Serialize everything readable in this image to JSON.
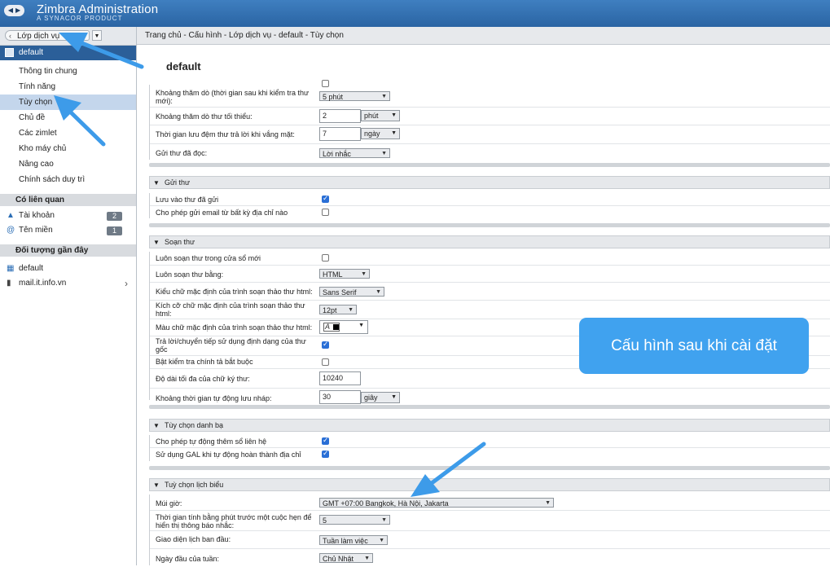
{
  "app": {
    "title": "Zimbra Administration",
    "subtitle": "A SYNACOR PRODUCT"
  },
  "nav": {
    "back_icon": "◀",
    "forward_icon": "▶"
  },
  "sidebar": {
    "breadcrumb_label": "Lớp dịch vụ",
    "selected": "default",
    "items": [
      {
        "label": "Thông tin chung"
      },
      {
        "label": "Tính năng"
      },
      {
        "label": "Tùy chọn"
      },
      {
        "label": "Chủ đề"
      },
      {
        "label": "Các zimlet"
      },
      {
        "label": "Kho máy chủ"
      },
      {
        "label": "Nâng cao"
      },
      {
        "label": "Chính sách duy trì"
      }
    ],
    "related_header": "Có liên quan",
    "related": [
      {
        "label": "Tài khoản",
        "count": "2",
        "icon": "account-icon"
      },
      {
        "label": "Tên miền",
        "count": "1",
        "icon": "domain-icon"
      }
    ],
    "recent_header": "Đối tượng gần đây",
    "recent": [
      {
        "label": "default",
        "icon": "cos-icon"
      },
      {
        "label": "mail.it.info.vn",
        "icon": "server-icon"
      }
    ]
  },
  "breadcrumb": "Trang chủ - Cấu hình - Lớp dịch vụ - default - Tùy chọn",
  "page": {
    "title": "default"
  },
  "sections": {
    "top": {
      "poll_label": "Khoảng thăm dò (thời gian sau khi kiểm tra thư mới):",
      "poll_value": "5 phút",
      "min_poll_label": "Khoảng thăm dò thư tối thiểu:",
      "min_poll_value": "2",
      "min_poll_unit": "phút",
      "ooo_cache_label": "Thời gian lưu đệm thư trả lời khi vắng mặt:",
      "ooo_cache_value": "7",
      "ooo_cache_unit": "ngày",
      "read_receipt_label": "Gửi thư đã đọc:",
      "read_receipt_value": "Lời nhắc"
    },
    "send": {
      "title": "Gửi thư",
      "save_sent_label": "Lưu vào thư đã gửi",
      "save_sent_checked": true,
      "allow_any_from_label": "Cho phép gửi email từ bất kỳ địa chỉ nào",
      "allow_any_from_checked": false
    },
    "compose": {
      "title": "Soạn thư",
      "new_window_label": "Luôn soạn thư trong cửa sổ mới",
      "new_window_checked": false,
      "format_label": "Luôn soạn thư bằng:",
      "format_value": "HTML",
      "font_label": "Kiểu chữ mặc định của trình soạn thảo thư html:",
      "font_value": "Sans Serif",
      "size_label": "Kích cỡ chữ mặc định của trình soạn thảo thư html:",
      "size_value": "12pt",
      "color_label": "Màu chữ mặc định của trình soạn thảo thư html:",
      "reply_format_label": "Trả lời/chuyển tiếp sử dụng định dạng của thư gốc",
      "reply_format_checked": true,
      "spellcheck_label": "Bật kiểm tra chính tả bắt buộc",
      "spellcheck_checked": false,
      "sig_len_label": "Độ dài tối đa của chữ ký thư:",
      "sig_len_value": "10240",
      "autosave_label": "Khoảng thời gian tự động lưu nháp:",
      "autosave_value": "30",
      "autosave_unit": "giây"
    },
    "contacts": {
      "title": "Tùy chọn danh bạ",
      "auto_add_label": "Cho phép tự động thêm sổ liên hệ",
      "auto_add_checked": true,
      "gal_label": "Sử dụng GAL khi tự động hoàn thành địa chỉ",
      "gal_checked": true
    },
    "calendar": {
      "title": "Tuỳ chọn lịch biểu",
      "timezone_label": "Múi giờ:",
      "timezone_value": "GMT +07:00 Bangkok, Hà Nội, Jakarta",
      "reminder_label": "Thời gian tính bằng phút trước một cuộc hẹn để hiển thị thông báo nhắc:",
      "reminder_value": "5",
      "view_label": "Giao diện lịch ban đầu:",
      "view_value": "Tuần làm việc",
      "week_start_label": "Ngày đầu của tuần:",
      "week_start_value": "Chủ Nhật"
    }
  },
  "callout": {
    "text": "Cấu hình sau khi cài đặt"
  },
  "colors": {
    "banner": "#2f6fb0",
    "selection": "#2b5f99",
    "callout": "#40a2ef",
    "arrow": "#3d9be9"
  }
}
